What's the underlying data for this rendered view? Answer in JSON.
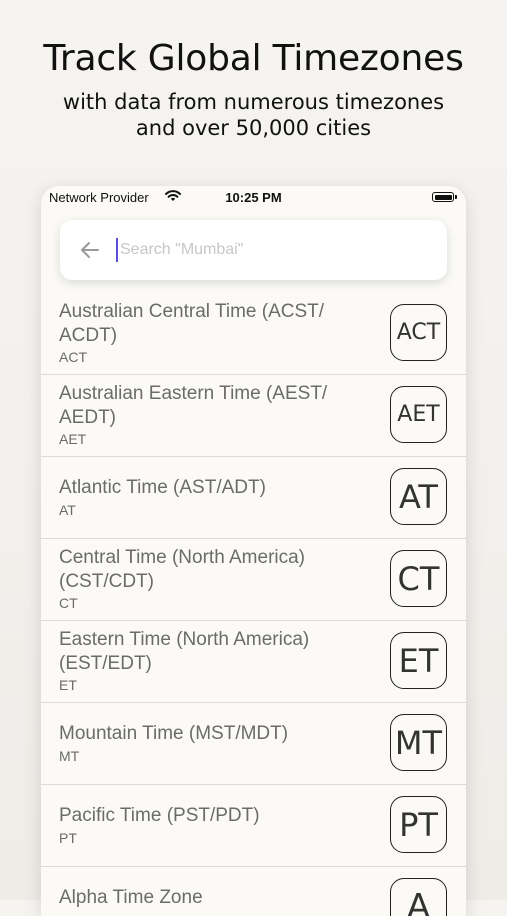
{
  "hero": {
    "title": "Track Global Timezones",
    "subtitle_line1": "with data from numerous timezones",
    "subtitle_line2": "and over 50,000 cities"
  },
  "status_bar": {
    "carrier": "Network Provider",
    "time": "10:25 PM",
    "wifi_icon": "wifi-icon",
    "battery_icon": "battery-icon"
  },
  "search": {
    "placeholder": "Search \"Mumbai\"",
    "value": "",
    "back_icon": "arrow-left-icon"
  },
  "timezones": [
    {
      "name_line1": "Australian Central Time (ACST/",
      "name_line2": "ACDT)",
      "code": "ACT",
      "badge": "ACT"
    },
    {
      "name_line1": "Australian Eastern Time (AEST/",
      "name_line2": "AEDT)",
      "code": "AET",
      "badge": "AET"
    },
    {
      "name_line1": "Atlantic Time (AST/ADT)",
      "name_line2": "",
      "code": "AT",
      "badge": "AT"
    },
    {
      "name_line1": "Central Time (North America)",
      "name_line2": "(CST/CDT)",
      "code": "CT",
      "badge": "CT"
    },
    {
      "name_line1": "Eastern Time (North America)",
      "name_line2": "(EST/EDT)",
      "code": "ET",
      "badge": "ET"
    },
    {
      "name_line1": "Mountain Time (MST/MDT)",
      "name_line2": "",
      "code": "MT",
      "badge": "MT"
    },
    {
      "name_line1": "Pacific Time (PST/PDT)",
      "name_line2": "",
      "code": "PT",
      "badge": "PT"
    },
    {
      "name_line1": "Alpha Time Zone",
      "name_line2": "",
      "code": "",
      "badge": "A"
    }
  ]
}
